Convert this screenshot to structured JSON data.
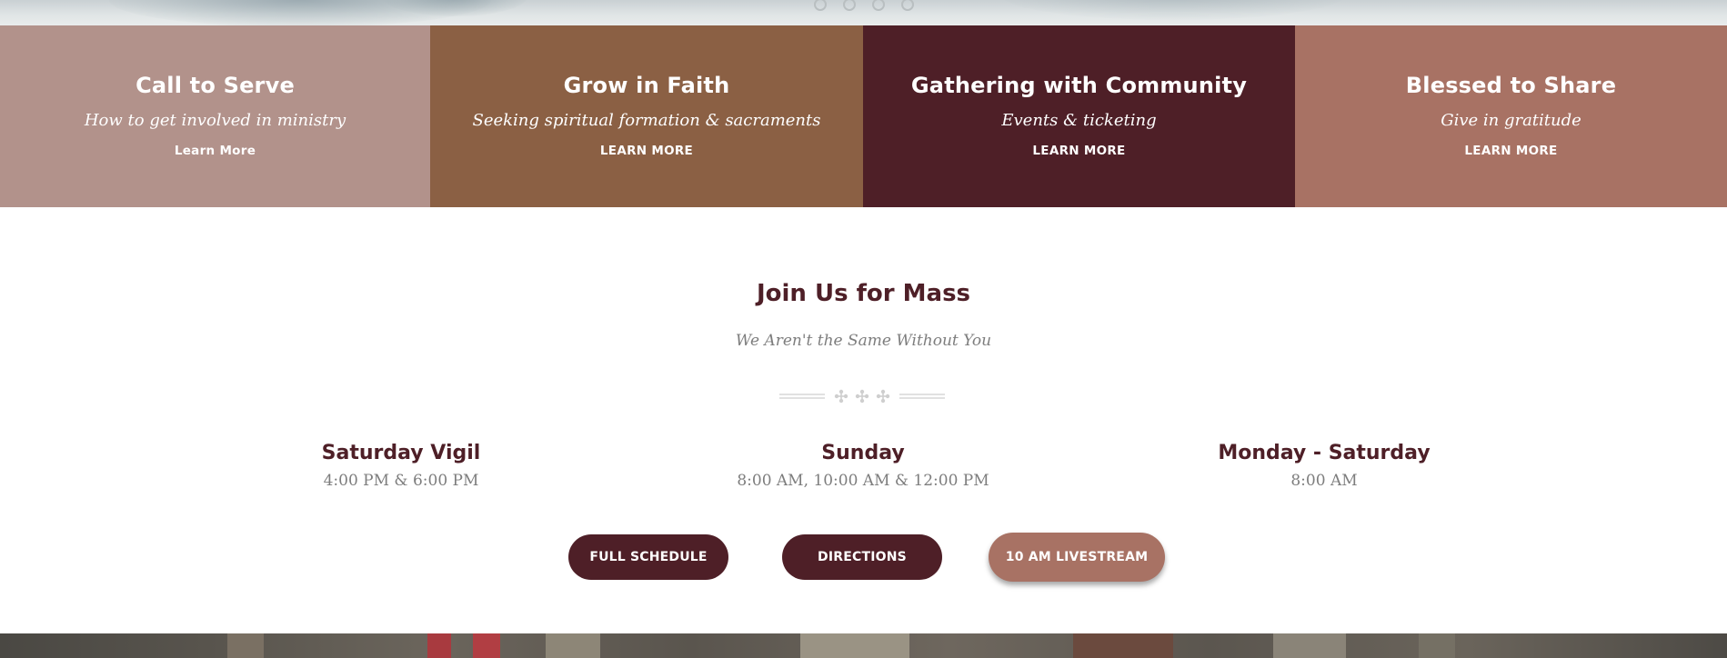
{
  "hero": {
    "slider_dots": [
      {
        "label": "slide-1"
      },
      {
        "label": "slide-2"
      },
      {
        "label": "slide-3"
      },
      {
        "label": "slide-4"
      }
    ]
  },
  "tiles": [
    {
      "title": "Call to Serve",
      "subtitle": "How to get involved in ministry",
      "link": "Learn More",
      "color": "#b2928b"
    },
    {
      "title": "Grow in Faith",
      "subtitle": "Seeking spiritual formation & sacraments",
      "link": "LEARN MORE",
      "color": "#8b6044"
    },
    {
      "title": "Gathering with Community",
      "subtitle": "Events & ticketing",
      "link": "LEARN MORE",
      "color": "#4e1f27"
    },
    {
      "title": "Blessed to Share",
      "subtitle": "Give in gratitude",
      "link": "LEARN MORE",
      "color": "#a87264"
    }
  ],
  "mass": {
    "title": "Join Us for Mass",
    "subtitle": "We Aren't the Same Without You",
    "schedules": [
      {
        "heading": "Saturday Vigil",
        "times": "4:00 PM & 6:00 PM"
      },
      {
        "heading": "Sunday",
        "times": "8:00 AM, 10:00 AM & 12:00 PM"
      },
      {
        "heading": "Monday - Saturday",
        "times": "8:00 AM"
      }
    ],
    "buttons": {
      "full_schedule": "FULL SCHEDULE",
      "directions": "DIRECTIONS",
      "livestream": "10 AM LIVESTREAM"
    }
  },
  "colors": {
    "primary": "#4e1f27",
    "accent": "#a87264",
    "muted_text": "#7d7d7d"
  }
}
